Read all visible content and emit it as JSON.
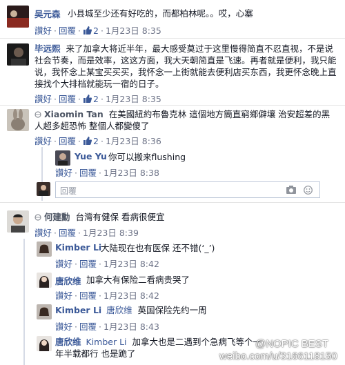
{
  "actions": {
    "like": "讚好",
    "reply": "回覆",
    "sep": "·"
  },
  "comments": [
    {
      "name": "吴元森",
      "text": "小县城至少还有好吃的，而都柏林呢。。哎，心塞",
      "likes": "2",
      "time": "1月23日 8:35"
    },
    {
      "name": "毕远熙",
      "text": "来了加拿大将近半年，最大感受莫过于这里慢得简直不忍直视，不是说社会节奏，而是效率，这这方面，我大天朝简直是飞速。再者就是便利，我只能说，我怀念上某宝买买买，我怀念一上街就能去便利店买东西，我更怀念晚上直接找个大排档就能玩一宿的日子。",
      "likes": "2",
      "time": "1月23日 8:35"
    },
    {
      "name": "Xiaomin Tan",
      "text": "在美國紐約布魯克林 這個地方簡直窮鄉僻壤 治安超差的黑人超多超恐怖 整個人都變傻了",
      "likes": "2",
      "time": "1月23日 8:36"
    },
    {
      "name": "Yue Yu",
      "text": "你可以搬来flushing",
      "likes": "",
      "time": "1月23日 8:38"
    },
    {
      "name": "何建勳",
      "text": "台灣有健保 看病很便宜",
      "likes": "",
      "time": "1月23日 8:39"
    },
    {
      "name": "Kimber Li",
      "text": "大陆现在也有医保 还不错(‘_’)",
      "likes": "",
      "time": "1月23日 8:42"
    },
    {
      "name": "唐欣维",
      "text": "加拿大有保险二看病贵哭了",
      "likes": "",
      "time": "1月23日 8:42"
    },
    {
      "name": "Kimber Li",
      "mention": "唐欣维",
      "text": "英国保险先约一周",
      "likes": "",
      "time": "1月23日 8:43"
    },
    {
      "name": "唐欣维",
      "mention": "Kimber Li",
      "text": "加拿大也是二遇到个急病飞等个一年半载都行 也是跪了",
      "likes": "",
      "time": ""
    }
  ],
  "reply_box": {
    "placeholder": "回覆"
  },
  "watermark": {
    "line1": "@NOPIC BEST",
    "line2": "weibo.com/u/3166118150"
  },
  "colors": {
    "link": "#3b5998",
    "time": "#6d7387",
    "thread_line": "#d6dbe6"
  }
}
